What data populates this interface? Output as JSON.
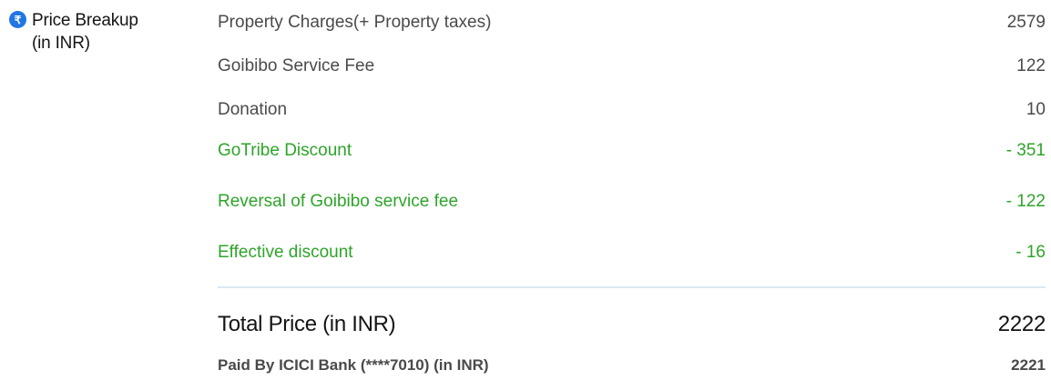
{
  "price_breakup": {
    "icon": "rupee-icon",
    "icon_glyph": "₹",
    "title_line1": "Price Breakup",
    "title_line2": "(in INR)",
    "accent_color": "#2276e3"
  },
  "line_items": [
    {
      "label": "Property Charges(+ Property taxes)",
      "value": "2579",
      "type": "charge"
    },
    {
      "label": "Goibibo Service Fee",
      "value": "122",
      "type": "charge"
    },
    {
      "label": "Donation",
      "value": "10",
      "type": "charge"
    },
    {
      "label": "GoTribe Discount",
      "value": "- 351",
      "type": "discount"
    },
    {
      "label": "Reversal of Goibibo service fee",
      "value": "- 122",
      "type": "discount"
    },
    {
      "label": "Effective discount",
      "value": "- 16",
      "type": "discount"
    }
  ],
  "total": {
    "label": "Total Price (in INR)",
    "value": "2222"
  },
  "paid": {
    "label": "Paid By ICICI Bank (****7010) (in INR)",
    "value": "2221"
  },
  "colors": {
    "discount": "#2ea42a",
    "text": "#4a4a4a",
    "heading": "#141414"
  }
}
